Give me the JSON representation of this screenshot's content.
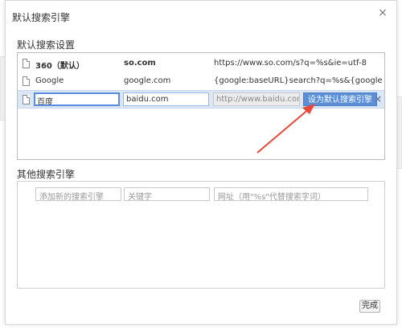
{
  "dialog": {
    "title": "默认搜索引擎",
    "close_glyph": "×"
  },
  "default_section": {
    "title": "默认搜索设置",
    "rows": [
      {
        "name": "360（默认）",
        "keyword": "so.com",
        "url": "https://www.so.com/s?q=%s&ie=utf-8"
      },
      {
        "name": "Google",
        "keyword": "google.com",
        "url": "{google:baseURL}search?q=%s&{google:RLZ}{goo..."
      }
    ],
    "selected_row": {
      "name": "百度",
      "keyword": "baidu.com",
      "url": "http://www.baidu.com/s?ie=",
      "set_default_label": "设为默认搜索引擎",
      "remove_glyph": "×"
    }
  },
  "other_section": {
    "title": "其他搜索引擎",
    "add_name_placeholder": "添加新的搜索引擎",
    "keyword_placeholder": "关键字",
    "url_placeholder": "网址（用\"%s\"代替搜索字词）"
  },
  "footer": {
    "ok_label": "完成"
  },
  "colors": {
    "selection": "#dbe6f7",
    "button_blue": "#5b8fd6",
    "arrow_red": "#e8473c"
  }
}
